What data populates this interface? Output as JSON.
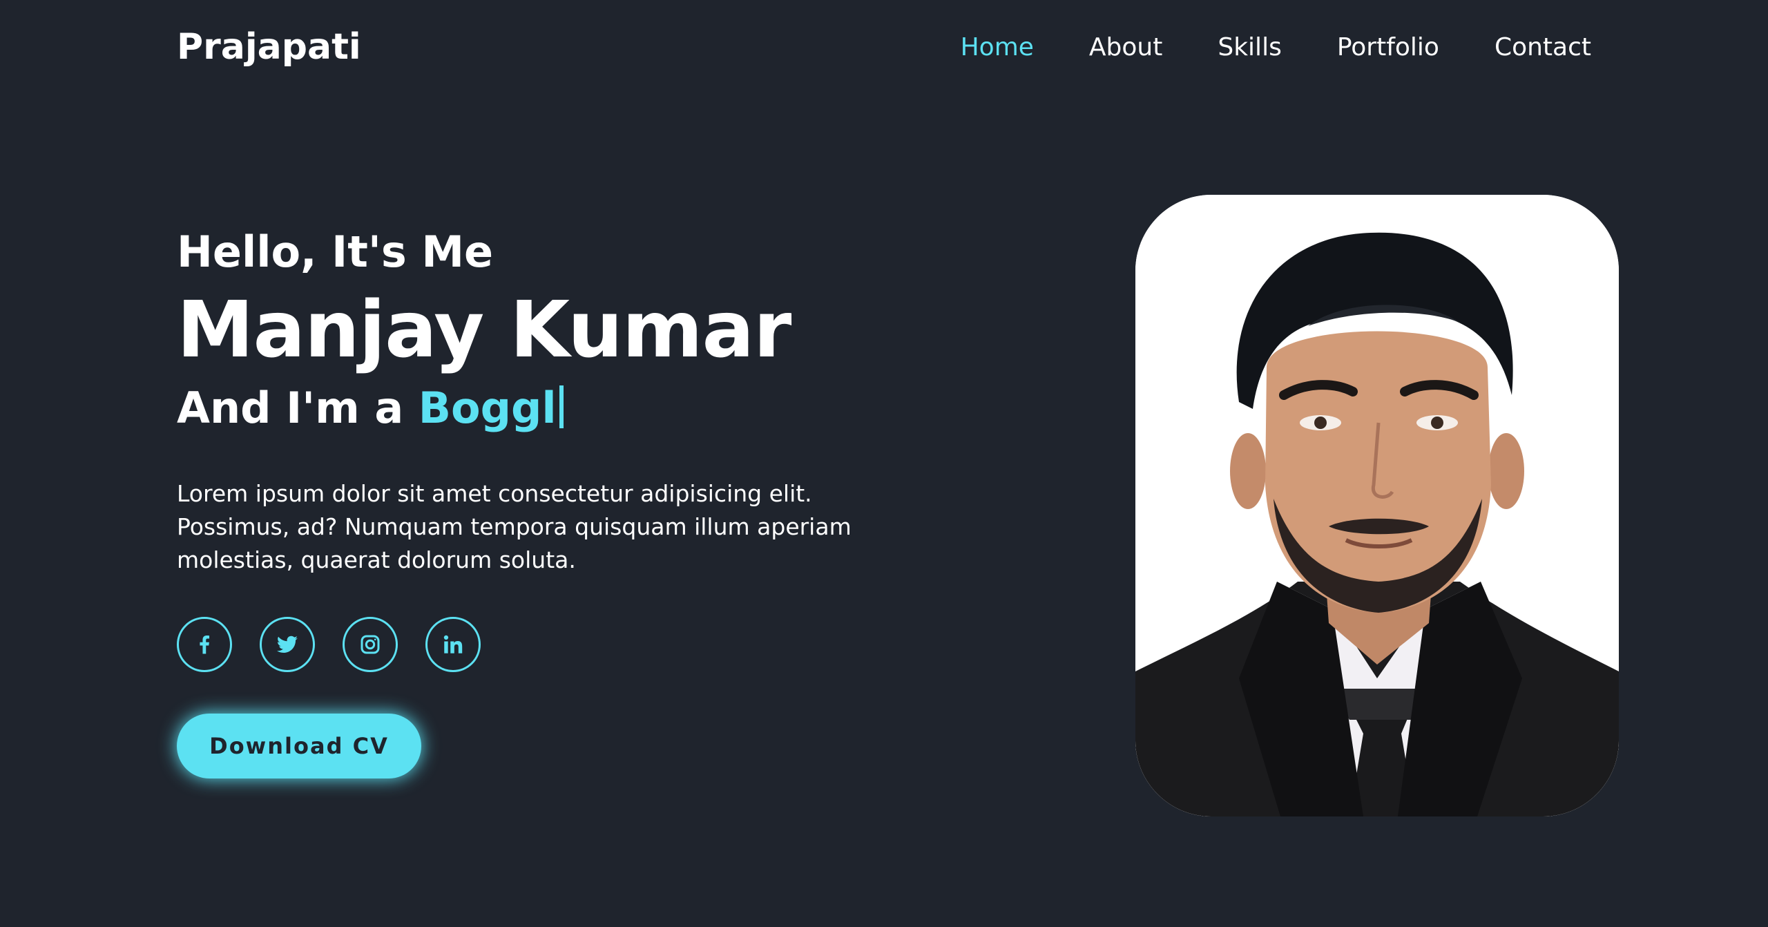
{
  "header": {
    "logo": "Prajapati",
    "nav": [
      "Home",
      "About",
      "Skills",
      "Portfolio",
      "Contact"
    ],
    "active_nav": "Home"
  },
  "hero": {
    "greeting": "Hello, It's Me",
    "name": "Manjay Kumar",
    "role_prefix": "And I'm a ",
    "role_typed": "Boggl",
    "bio": "Lorem ipsum dolor sit amet consectetur adipisicing elit. Possimus, ad? Numquam tempora quisquam illum aperiam molestias, quaerat dolorum soluta.",
    "socials": [
      "facebook-icon",
      "twitter-icon",
      "instagram-icon",
      "linkedin-icon"
    ],
    "button_label": "Download CV"
  },
  "colors": {
    "background": "#1f242d",
    "accent": "#5ce1f2",
    "text": "#ffffff"
  }
}
